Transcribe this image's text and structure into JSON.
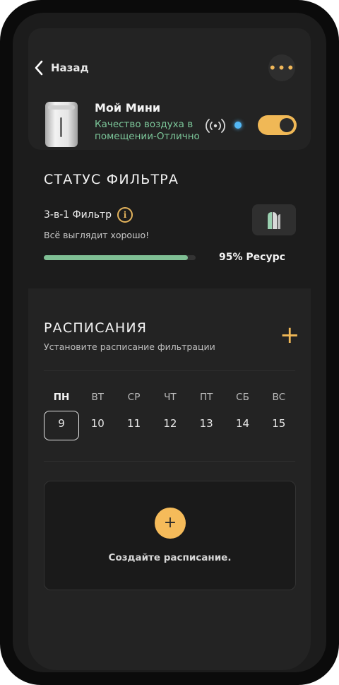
{
  "header": {
    "back_label": "Назад",
    "more_label": "•••"
  },
  "device": {
    "name": "Мой Мини",
    "status": "Качество воздуха в помещении-Отлично",
    "power_on": true,
    "accent_color": "#f0b856",
    "status_color": "#7cc79a"
  },
  "filter": {
    "title": "СТАТУС ФИЛЬТРА",
    "name": "3-в-1 Фильтр",
    "info_icon": "i",
    "message": "Всё выглядит хорошо!",
    "progress_fraction": 0.95,
    "resource_label": "95% Ресурс",
    "progress_color": "#7fbf94"
  },
  "schedule": {
    "title": "РАСПИСАНИЯ",
    "subtitle": "Установите расписание фильтрации",
    "add_label": "+",
    "days": [
      {
        "label": "ПН",
        "num": "9",
        "selected": true
      },
      {
        "label": "ВТ",
        "num": "10",
        "selected": false
      },
      {
        "label": "СР",
        "num": "11",
        "selected": false
      },
      {
        "label": "ЧТ",
        "num": "12",
        "selected": false
      },
      {
        "label": "ПТ",
        "num": "13",
        "selected": false
      },
      {
        "label": "СБ",
        "num": "14",
        "selected": false
      },
      {
        "label": "ВС",
        "num": "15",
        "selected": false
      }
    ],
    "empty_add_label": "+",
    "empty_label": "Создайте расписание."
  }
}
